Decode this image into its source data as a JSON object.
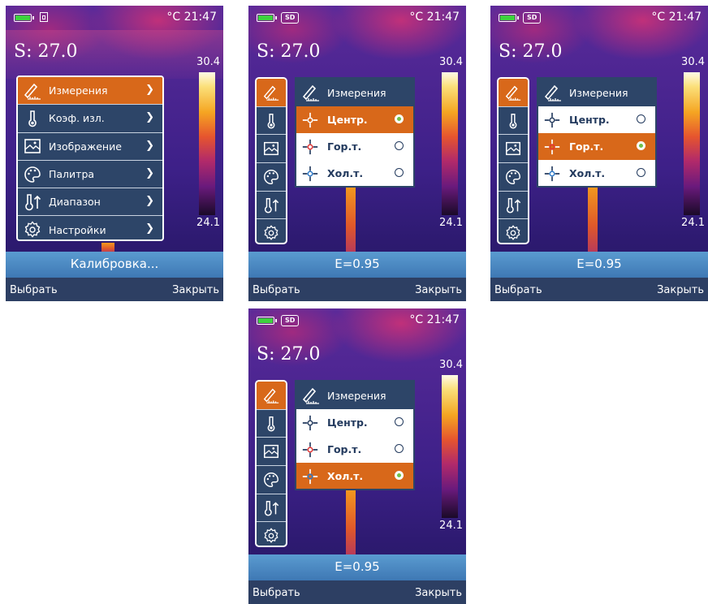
{
  "status": {
    "clock": "°C 21:47",
    "sd_label": "SD"
  },
  "readout": {
    "s_value": "S: 27.0",
    "scale_max": "30.4",
    "scale_min": "24.1"
  },
  "band": {
    "calibration": "Калибровка...",
    "emissivity": "E=0.95"
  },
  "footer": {
    "select": "Выбрать",
    "close": "Закрыть"
  },
  "menu": {
    "items": [
      {
        "label": "Измерения",
        "icon": "measure-icon"
      },
      {
        "label": "Коэф. изл.",
        "icon": "thermometer-icon"
      },
      {
        "label": "Изображение",
        "icon": "image-icon"
      },
      {
        "label": "Палитра",
        "icon": "palette-icon"
      },
      {
        "label": "Диапазон",
        "icon": "range-icon"
      },
      {
        "label": "Настройки",
        "icon": "settings-icon"
      }
    ]
  },
  "submenu": {
    "title": "Измерения",
    "options": [
      {
        "label": "Центр.",
        "icon": "center-point-icon"
      },
      {
        "label": "Гор.т.",
        "icon": "hot-point-icon"
      },
      {
        "label": "Хол.т.",
        "icon": "cold-point-icon"
      }
    ]
  },
  "colors": {
    "accent": "#d8681a",
    "panel": "#2d4568",
    "footer": "#2d3f63",
    "selected_radio": "#6fc04a",
    "hot_marker": "#e23030",
    "cold_marker": "#2a78c8"
  }
}
